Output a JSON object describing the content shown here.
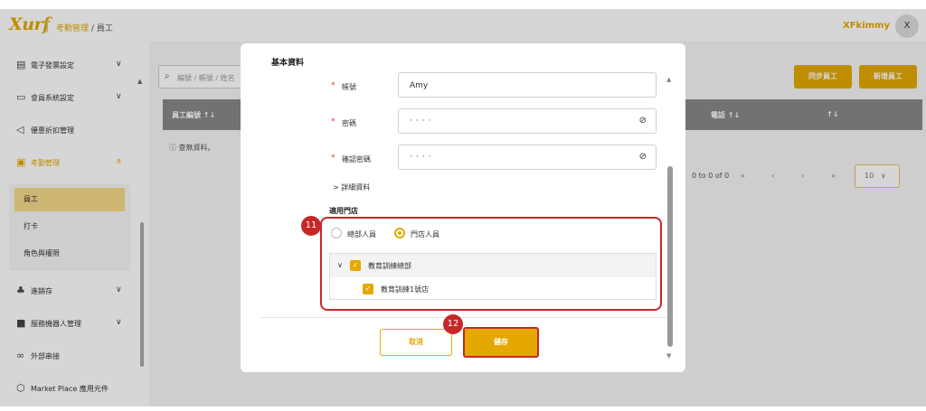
{
  "app": {
    "logo": "Xurf",
    "breadcrumb_section": "考勤管理",
    "breadcrumb_sep": "/",
    "breadcrumb_page": "員工",
    "user_name": "XFkimmy",
    "avatar_initial": "X"
  },
  "sidebar": {
    "items": [
      {
        "label": "電子發票設定",
        "icon": "invoice-icon",
        "chevron": "∨"
      },
      {
        "label": "會員系統設定",
        "icon": "member-card-icon",
        "chevron": "∨"
      },
      {
        "label": "優惠折扣管理",
        "icon": "megaphone-icon"
      },
      {
        "label": "考勤管理",
        "icon": "attendance-icon",
        "chevron": "∧"
      },
      {
        "label": "進銷存",
        "icon": "inventory-icon",
        "chevron": "∨"
      },
      {
        "label": "服務機器人管理",
        "icon": "robot-icon",
        "chevron": "∨"
      },
      {
        "label": "外部串接",
        "icon": "link-icon"
      },
      {
        "label": "Market Place 應用元件",
        "icon": "cube-icon"
      }
    ],
    "subitems": [
      "員工",
      "打卡",
      "角色與權限"
    ]
  },
  "main": {
    "search_placeholder": "編號 / 帳號 / 姓名",
    "sync_button": "同步員工",
    "add_button": "新增員工",
    "columns": [
      "員工編號 ↑↓",
      "電話 ↑↓",
      "↑↓"
    ],
    "empty_text": "查無資料。",
    "pager_text": "0 to 0 of 0",
    "pager_first": "«",
    "pager_prev": "‹",
    "pager_next": "›",
    "pager_last": "»",
    "page_size": "10"
  },
  "modal": {
    "title": "基本資料",
    "required_mark": "*",
    "fields": [
      {
        "label": "帳號",
        "value": "Amy"
      },
      {
        "label": "密碼",
        "value": "····"
      },
      {
        "label": "確認密碼",
        "value": "····"
      }
    ],
    "details_toggle": "> 詳細資料",
    "store_section_title": "適用門店",
    "radio_hq": "總部人員",
    "radio_store": "門店人員",
    "tree_parent": "教育訓練總部",
    "tree_child": "教育訓練1號店",
    "cancel_button": "取消",
    "save_button": "儲存"
  },
  "annotations": {
    "step_a": "11",
    "step_b": "12",
    "highlight_color": "#c62828"
  },
  "colors": {
    "accent": "#e4a800",
    "table_header": "#888888",
    "required": "#e53935"
  }
}
